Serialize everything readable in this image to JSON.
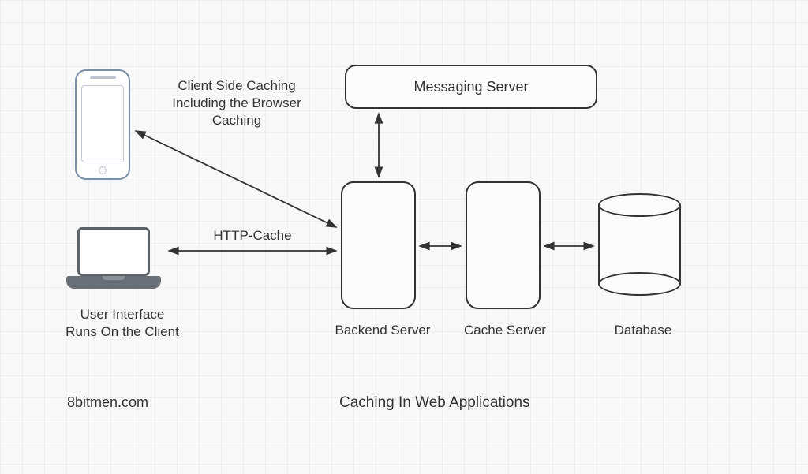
{
  "diagram": {
    "title": "Caching In Web Applications",
    "attribution": "8bitmen.com",
    "nodes": {
      "messaging_server": "Messaging Server",
      "backend_server": "Backend Server",
      "cache_server": "Cache Server",
      "database": "Database",
      "client_label": "User Interface\nRuns On the Client"
    },
    "annotations": {
      "client_side_caching": "Client Side Caching\nIncluding the Browser\nCaching",
      "http_cache": "HTTP-Cache"
    }
  }
}
